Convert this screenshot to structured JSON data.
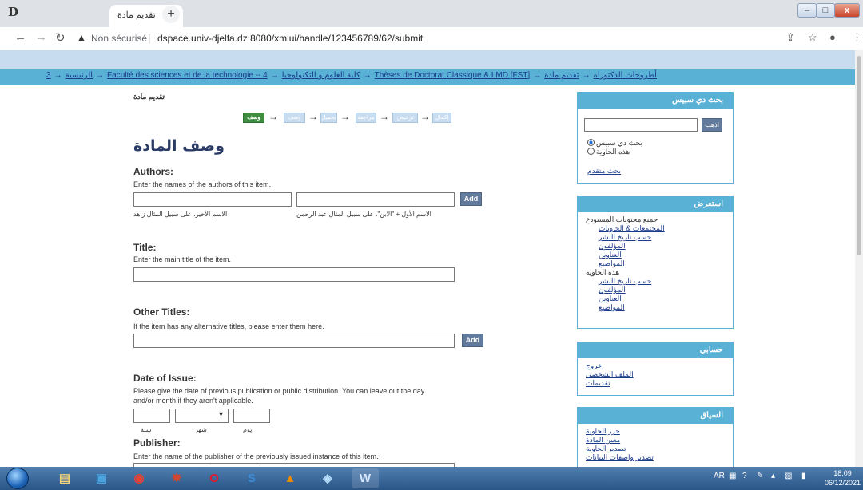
{
  "browser": {
    "tab_favicon": "D",
    "tab_title": "تقديم مادة",
    "tab_close": "×",
    "new_tab": "+",
    "window_min": "–",
    "window_max": "□",
    "window_close": "x",
    "not_secure": "Non sécurisé",
    "url": "dspace.univ-djelfa.dz:8080/xmlui/handle/123456789/62/submit",
    "icons": [
      "back-icon",
      "forward-icon",
      "reload-icon",
      "warning-icon",
      "share-icon",
      "star-icon",
      "profile-icon",
      "menu-icon"
    ]
  },
  "trail": {
    "items": [
      "أطروحات الدكتوراه",
      "تقديم مادة",
      "[FST] Thèses de Doctorat Classique & LMD",
      "كلية العلوم و التكنولوجيا",
      "Faculté des sciences et de la technologie -- 4",
      "الرئيسية",
      "3"
    ],
    "separator": "→"
  },
  "page": {
    "heading": "تقديم مادة",
    "section_title": "وصف المادة",
    "steps": [
      "وصف",
      "وصف",
      "تحميل",
      "مراجعة",
      "ترخيص",
      "إكمال"
    ]
  },
  "form": {
    "authors": {
      "label": "Authors:",
      "help": "Enter the names of the authors of this item.",
      "last_hint": "الاسم الأخير، على سبيل المثال زاهد",
      "first_hint": "الاسم الأول + \"الابن\"، على سبيل المثال عبد الرحمن",
      "add": "Add"
    },
    "title": {
      "label": "Title:",
      "help": "Enter the main title of the item."
    },
    "other_titles": {
      "label": "Other Titles:",
      "help": "If the item has any alternative titles, please enter them here.",
      "add": "Add"
    },
    "date": {
      "label": "Date of Issue:",
      "help_line1": "Please give the date of previous publication or public distribution. You can leave out the day",
      "help_line2": "and/or month if they aren't applicable.",
      "year": "سنة",
      "month": "شهر",
      "day": "يوم"
    },
    "publisher": {
      "label": "Publisher:",
      "help": "Enter the name of the publisher of the previously issued instance of this item."
    }
  },
  "sidebar": {
    "search": {
      "title": "بحث دي سبيس",
      "go": "اذهب",
      "option_all": "بحث دي سبيس",
      "option_collection": "هذه الحاوية",
      "advanced": "بحث متقدم"
    },
    "browse": {
      "title": "استعرض",
      "all_heading": "جميع محتويات المستودع",
      "all_links": [
        "المجتمعات & الحاويات",
        "حسب تاريخ النشر",
        "المؤلفون",
        "العناوين",
        "المواضيع"
      ],
      "coll_heading": "هذه الحاوية",
      "coll_links": [
        "حسب تاريخ النشر",
        "المؤلفون",
        "العناوين",
        "المواضيع"
      ]
    },
    "account": {
      "title": "حسابي",
      "links": [
        "خروج",
        "الملف الشخصي",
        "تقديمات"
      ]
    },
    "context": {
      "title": "السياق",
      "links": [
        "حرر الحاوية",
        "معين المادة",
        "تصدير الحاوية",
        "تصدير واصفات البيانات"
      ]
    }
  },
  "taskbar": {
    "lang": "AR",
    "time": "18:09",
    "date": "06/12/2021"
  }
}
